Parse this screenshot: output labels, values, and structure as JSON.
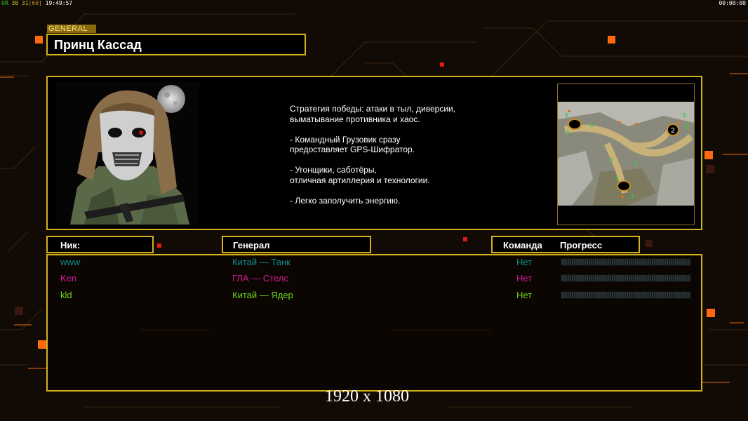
{
  "hud": {
    "left_prefix": "UR",
    "left_values": "30 31",
    "left_bracket": "[60]",
    "left_time": "19:49:57",
    "right_time": "00:00:00"
  },
  "general_tag": "GENERAL",
  "general_name": "Принц Кассад",
  "portrait_icon": "hooded-soldier-portrait",
  "description": "Стратегия победы: атаки в тыл, диверсии,\n выматывание противника и хаос.\n\n- Командный Грузовик сразу\nпредоставляет GPS-Шифратор.\n\n- Угонщики, саботёры,\nотличная артиллерия и технологии.\n\n- Легко заполучить энергию.",
  "minimap_icon": "terrain-minimap",
  "minimap_label": "2",
  "headers": {
    "nick": "Ник:",
    "general": "Генерал",
    "team": "Команда",
    "progress": "Прогресс"
  },
  "players": [
    {
      "nick": "www",
      "general": "Китай — Танк",
      "team": "Нет",
      "color": "#0f8f8f",
      "progress": 0
    },
    {
      "nick": "Ken",
      "general": "ГЛА — Стелс",
      "team": "Нет",
      "color": "#d9189c",
      "progress": 0
    },
    {
      "nick": "kld",
      "general": "Китай — Ядер",
      "team": "Нет",
      "color": "#6fd61d",
      "progress": 0
    }
  ],
  "resolution": "1920 x 1080",
  "colors": {
    "frame": "#d4b21c",
    "background": "#120a04",
    "accent_orange": "#ff6a10"
  }
}
